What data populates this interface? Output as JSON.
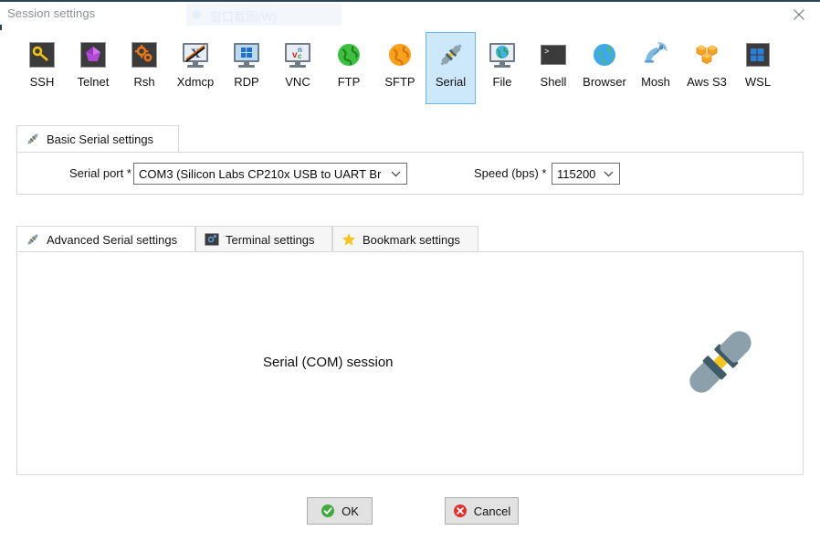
{
  "window": {
    "title": "Session settings",
    "close_label": "Close",
    "ghost_overlay_text": "窗口截图(W)"
  },
  "protocols": [
    {
      "id": "ssh",
      "label": "SSH",
      "icon": "key-icon",
      "selected": false
    },
    {
      "id": "telnet",
      "label": "Telnet",
      "icon": "gem-icon",
      "selected": false
    },
    {
      "id": "rsh",
      "label": "Rsh",
      "icon": "gears-icon",
      "selected": false
    },
    {
      "id": "xdmcp",
      "label": "Xdmcp",
      "icon": "x-monitor-icon",
      "selected": false
    },
    {
      "id": "rdp",
      "label": "RDP",
      "icon": "windows-monitor-icon",
      "selected": false
    },
    {
      "id": "vnc",
      "label": "VNC",
      "icon": "vnc-monitor-icon",
      "selected": false
    },
    {
      "id": "ftp",
      "label": "FTP",
      "icon": "green-globe-icon",
      "selected": false
    },
    {
      "id": "sftp",
      "label": "SFTP",
      "icon": "orange-globe-icon",
      "selected": false
    },
    {
      "id": "serial",
      "label": "Serial",
      "icon": "serial-plug-icon",
      "selected": true
    },
    {
      "id": "file",
      "label": "File",
      "icon": "file-monitor-icon",
      "selected": false
    },
    {
      "id": "shell",
      "label": "Shell",
      "icon": "terminal-icon",
      "selected": false
    },
    {
      "id": "browser",
      "label": "Browser",
      "icon": "blue-globe-icon",
      "selected": false
    },
    {
      "id": "mosh",
      "label": "Mosh",
      "icon": "satellite-icon",
      "selected": false
    },
    {
      "id": "awss3",
      "label": "Aws S3",
      "icon": "aws-cubes-icon",
      "selected": false
    },
    {
      "id": "wsl",
      "label": "WSL",
      "icon": "windows-icon",
      "selected": false
    }
  ],
  "basic_panel": {
    "tab_label": "Basic Serial settings",
    "tab_icon": "serial-plug-icon",
    "serial_port_label": "Serial port *",
    "serial_port_value": "COM3  (Silicon Labs CP210x USB to UART Br",
    "speed_label": "Speed (bps) *",
    "speed_value": "115200"
  },
  "lower_panel": {
    "tabs": [
      {
        "id": "advanced",
        "label": "Advanced Serial settings",
        "icon": "serial-plug-icon",
        "active": true
      },
      {
        "id": "terminal",
        "label": "Terminal settings",
        "icon": "terminal-gear-icon",
        "active": false
      },
      {
        "id": "bookmark",
        "label": "Bookmark settings",
        "icon": "star-icon",
        "active": false
      }
    ],
    "caption": "Serial (COM) session",
    "illustration_icon": "serial-plug-large-icon"
  },
  "footer": {
    "ok_label": "OK",
    "ok_icon": "green-check-icon",
    "cancel_label": "Cancel",
    "cancel_icon": "red-cross-icon"
  },
  "colors": {
    "titlebar_accent": "#2b4257",
    "selection_fill": "#cde8fb",
    "selection_border": "#6cb4e8",
    "panel_border": "#d8d8d8",
    "button_face": "#e1e1e1",
    "ok_green": "#3faa3f",
    "cancel_red": "#e03030",
    "star_yellow": "#f5c421"
  }
}
